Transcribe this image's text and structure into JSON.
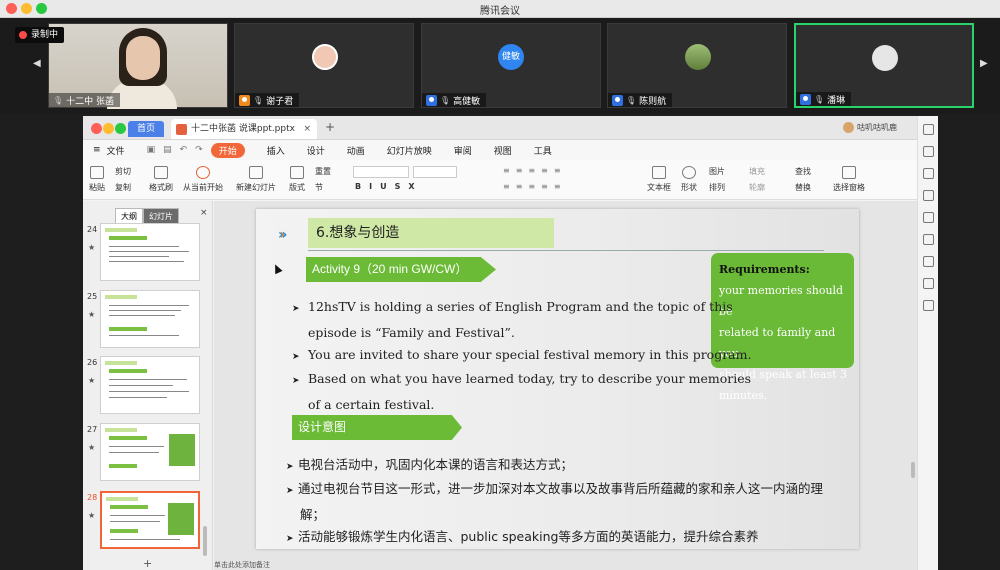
{
  "window": {
    "title": "腾讯会议"
  },
  "meeting": {
    "recording_label": "录制中",
    "participants": [
      {
        "name": "十二中 张菡",
        "avatar": "camera"
      },
      {
        "name": "谢子君",
        "avatar": "cartoon"
      },
      {
        "name": "高健敏",
        "avatar": "健敏"
      },
      {
        "name": "陈则航",
        "avatar": "photo"
      },
      {
        "name": "潘琳",
        "avatar": "default"
      }
    ]
  },
  "app": {
    "home_tab": "首页",
    "doc_tab": "十二中张菡 说课ppt.pptx",
    "user": "咕叽咕叽鹿",
    "menu": {
      "file": "文件",
      "start": "开始",
      "insert": "插入",
      "design": "设计",
      "animation": "动画",
      "slideshow": "幻灯片放映",
      "review": "审阅",
      "view": "视图",
      "tools": "工具"
    },
    "ribbon": {
      "paste": "粘贴",
      "cut": "剪切",
      "copy": "复制",
      "format_painter": "格式刷",
      "from_current": "从当前开始",
      "new_slide": "新建幻灯片",
      "layout": "版式",
      "reset": "重置",
      "section": "节",
      "textbox": "文本框",
      "shape": "形状",
      "picture": "图片",
      "fill": "填充",
      "arrange": "排列",
      "outline": "轮廓",
      "find": "查找",
      "replace": "替换",
      "select_pane": "选择窗格"
    },
    "left_pane": {
      "outline_tab": "大纲",
      "slides_tab": "幻灯片",
      "slides": [
        "24",
        "25",
        "26",
        "27",
        "28"
      ],
      "selected": "28"
    },
    "status": "单击此处添加备注"
  },
  "slide": {
    "title": "6.想象与创造",
    "activity": "Activity 9（20 min GW/CW）",
    "requirements_title": "Requirements:",
    "requirements_lines": [
      "your memories should be",
      "related to family and you",
      "should speak at least 3",
      "minutes."
    ],
    "bullets": [
      {
        "l1": "12hsTV is holding a series of English Program and the topic of this",
        "l2": "episode is “Family and Festival”."
      },
      {
        "l1": "You are invited to share your special festival memory in this program.",
        "l2": ""
      },
      {
        "l1": "Based on what you have learned today, try to describe your memories",
        "l2": "of a certain festival."
      }
    ],
    "design_label": "设计意图",
    "design_points": [
      {
        "l1": "电视台活动中，巩固内化本课的语言和表达方式；",
        "l2": ""
      },
      {
        "l1": "通过电视台节目这一形式，进一步加深对本文故事以及故事背后所蕴藏的家和亲人这一内涵的理",
        "l2": "解；"
      },
      {
        "l1": "活动能够锻炼学生内化语言、public speaking等多方面的英语能力，提升综合素养",
        "l2": ""
      }
    ]
  },
  "icons": {
    "arrow": "➤",
    "tile_prev": "◀",
    "tile_next": "▶",
    "mic": "🎙"
  },
  "colors": {
    "accent_green": "#6cbb37",
    "wps_orange": "#f2673a",
    "active_tile": "#2bd46b"
  }
}
